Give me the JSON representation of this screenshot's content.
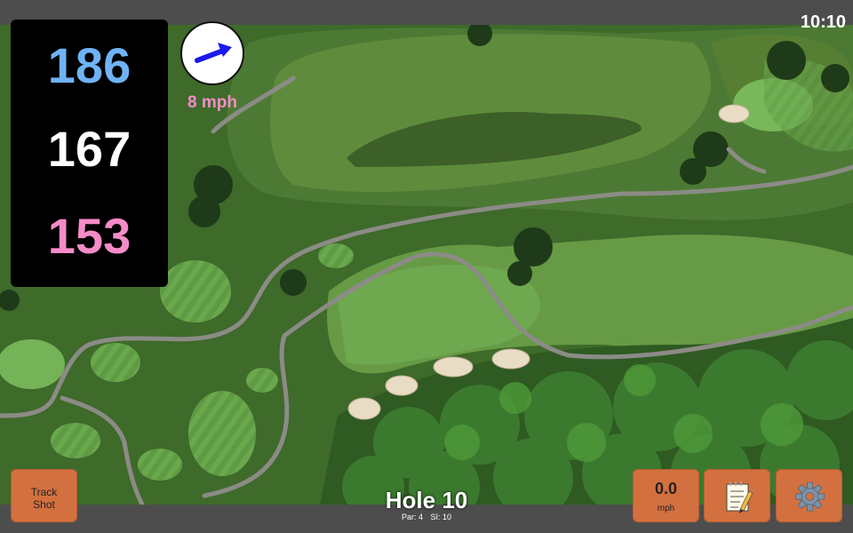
{
  "status": {
    "time": "10:10"
  },
  "yardages": {
    "back": "186",
    "middle": "167",
    "front": "153"
  },
  "wind": {
    "speed_text": "8 mph",
    "icon": "wind-direction-arrow-icon"
  },
  "hole": {
    "title": "Hole 10",
    "par": "Par: 4",
    "si": "SI: 10"
  },
  "buttons": {
    "track_shot_line1": "Track",
    "track_shot_line2": "Shot",
    "speed_value": "0.0",
    "speed_unit": "mph",
    "notes_icon": "notepad-icon",
    "settings_icon": "gear-icon"
  },
  "colors": {
    "back_yardage": "#6fb3f5",
    "front_yardage": "#f58cc8",
    "button": "#d3703f",
    "fairway": "#5e8a3a",
    "rough": "#3f6a2a"
  }
}
